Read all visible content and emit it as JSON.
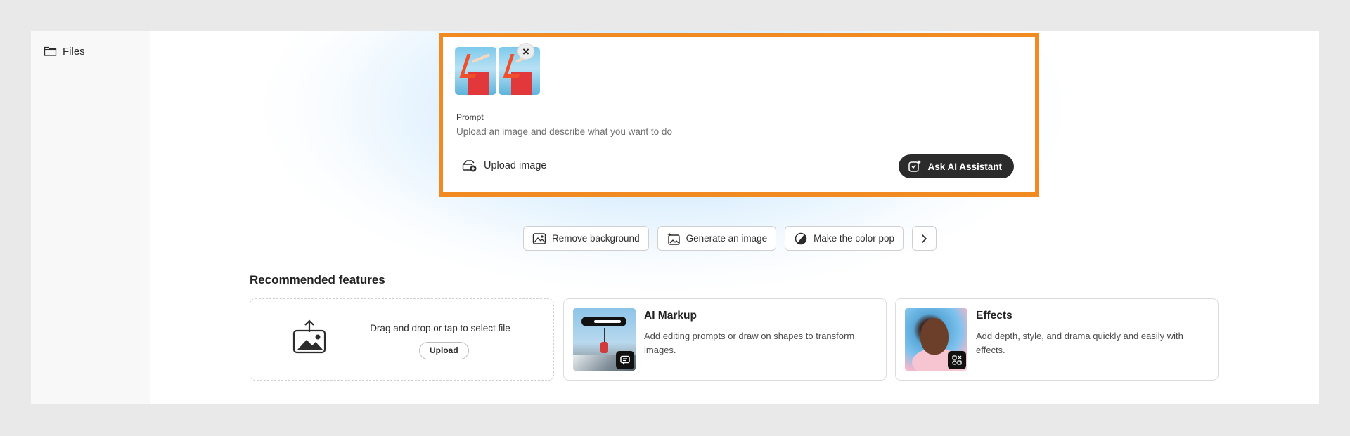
{
  "sidebar": {
    "items": [
      {
        "label": "Files",
        "icon": "folder-icon"
      }
    ]
  },
  "prompt": {
    "label": "Prompt",
    "placeholder": "Upload an image and describe what you want to do",
    "close_icon": "close-icon",
    "upload_label": "Upload image",
    "ask_label": "Ask AI Assistant"
  },
  "quick_actions": [
    {
      "label": "Remove background",
      "icon": "remove-background-icon"
    },
    {
      "label": "Generate an image",
      "icon": "generate-image-icon"
    },
    {
      "label": "Make the color pop",
      "icon": "color-pop-icon"
    }
  ],
  "recommended": {
    "title": "Recommended features",
    "dropzone": {
      "text": "Drag and drop or tap to select file",
      "button": "Upload"
    },
    "cards": [
      {
        "title": "AI Markup",
        "description": "Add editing prompts or draw on shapes to transform images."
      },
      {
        "title": "Effects",
        "description": "Add depth, style, and drama quickly and easily with effects."
      }
    ]
  },
  "colors": {
    "highlight_border": "#f28a22",
    "ask_button_bg": "#2b2b2b",
    "glow": "#aad7fa"
  }
}
